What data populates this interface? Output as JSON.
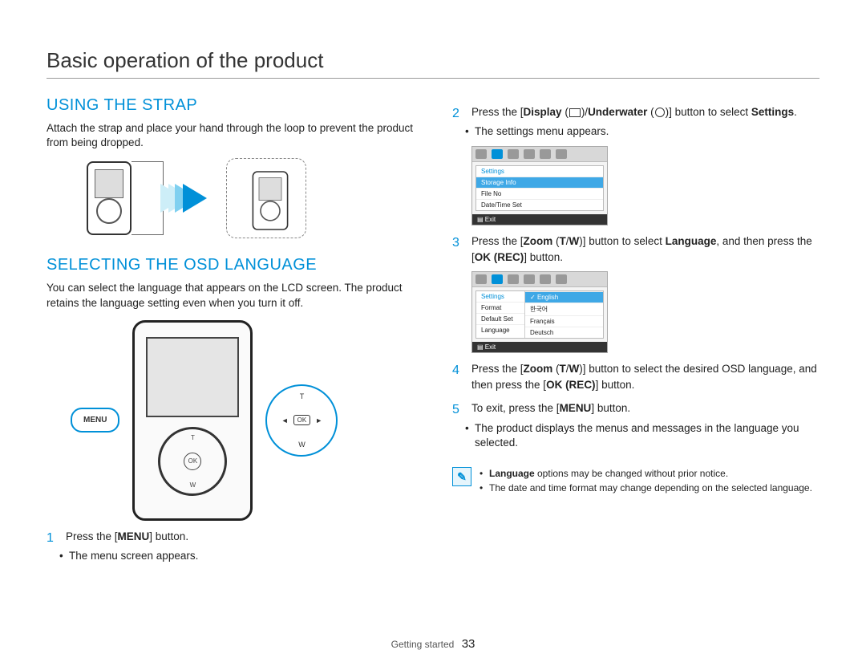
{
  "page_title": "Basic operation of the product",
  "footer_section": "Getting started",
  "footer_page": "33",
  "left": {
    "strap": {
      "heading": "USING THE STRAP",
      "body": "Attach the strap and place your hand through the loop to prevent the product from being dropped."
    },
    "osd": {
      "heading": "SELECTING THE OSD LANGUAGE",
      "body": "You can select the language that appears on the LCD screen. The product retains the language setting even when you turn it off."
    },
    "menu_bubble": "MENU",
    "wheel_ok": "OK",
    "zoom": {
      "t": "T",
      "w": "W",
      "ok": "OK",
      "left": "◄",
      "right": "►"
    },
    "step1": {
      "pre": "Press the [",
      "b": "MENU",
      "post": "] button."
    },
    "step1_bullet": "The menu screen appears."
  },
  "right": {
    "step2": {
      "pre": "Press the [",
      "b1": "Display",
      "mid1": " (",
      "mid2": ")/",
      "b2": "Underwater",
      "mid3": " (",
      "mid4": ")] button to select ",
      "b3": "Settings",
      "post": "."
    },
    "step2_bullet": "The settings menu appears.",
    "osd1": {
      "hdr": "Settings",
      "rows": [
        "Storage Info",
        "File No",
        "Date/Time Set"
      ],
      "exit": "Exit"
    },
    "step3": {
      "pre": "Press the [",
      "b1": "Zoom",
      "paren": " (",
      "b2": "T",
      "slash": "/",
      "b3": "W",
      "paren2": ")] button to select ",
      "b4": "Language",
      "mid": ", and then press the [",
      "b5": "OK (REC)",
      "post": "] button."
    },
    "osd2": {
      "hdr": "Settings",
      "left_rows": [
        "Format",
        "Default Set",
        "Language"
      ],
      "right_rows": [
        "English",
        "한국어",
        "Français",
        "Deutsch"
      ],
      "exit": "Exit"
    },
    "step4": {
      "pre": "Press the [",
      "b1": "Zoom",
      "paren": " (",
      "b2": "T",
      "slash": "/",
      "b3": "W",
      "paren2": ")] button to select the desired OSD language, and then press the [",
      "b4": "OK (REC)",
      "post": "] button."
    },
    "step5": {
      "pre": "To exit, press the [",
      "b": "MENU",
      "post": "] button."
    },
    "step5_bullet": "The product displays the menus and messages in the language you selected.",
    "notes": [
      {
        "pre": "",
        "b": "Language",
        "post": " options may be changed without prior notice."
      },
      {
        "pre": "The date and time format may change depending on the selected language.",
        "b": "",
        "post": ""
      }
    ]
  }
}
